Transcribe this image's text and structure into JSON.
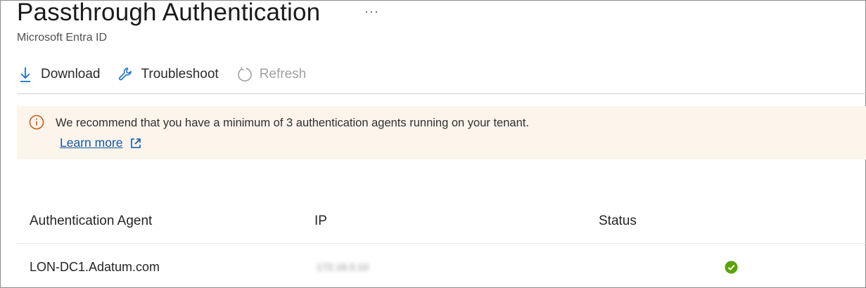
{
  "header": {
    "title": "Passthrough Authentication",
    "more_label": "···",
    "subtitle": "Microsoft Entra ID"
  },
  "toolbar": {
    "download_label": "Download",
    "troubleshoot_label": "Troubleshoot",
    "refresh_label": "Refresh",
    "refresh_disabled": true
  },
  "banner": {
    "message": "We recommend that you have a minimum of 3 authentication agents running on your tenant.",
    "link_label": "Learn more",
    "icon": "info-icon",
    "background": "#fdf4ec",
    "accent": "#c15b10"
  },
  "table": {
    "columns": [
      "Authentication Agent",
      "IP",
      "Status"
    ],
    "rows": [
      {
        "agent": "LON-DC1.Adatum.com",
        "ip": "172.16.0.10",
        "status": "healthy-check-icon"
      }
    ]
  },
  "colors": {
    "link": "#0f5aa3",
    "icon_blue": "#1a73c9",
    "status_ok": "#57a300"
  }
}
